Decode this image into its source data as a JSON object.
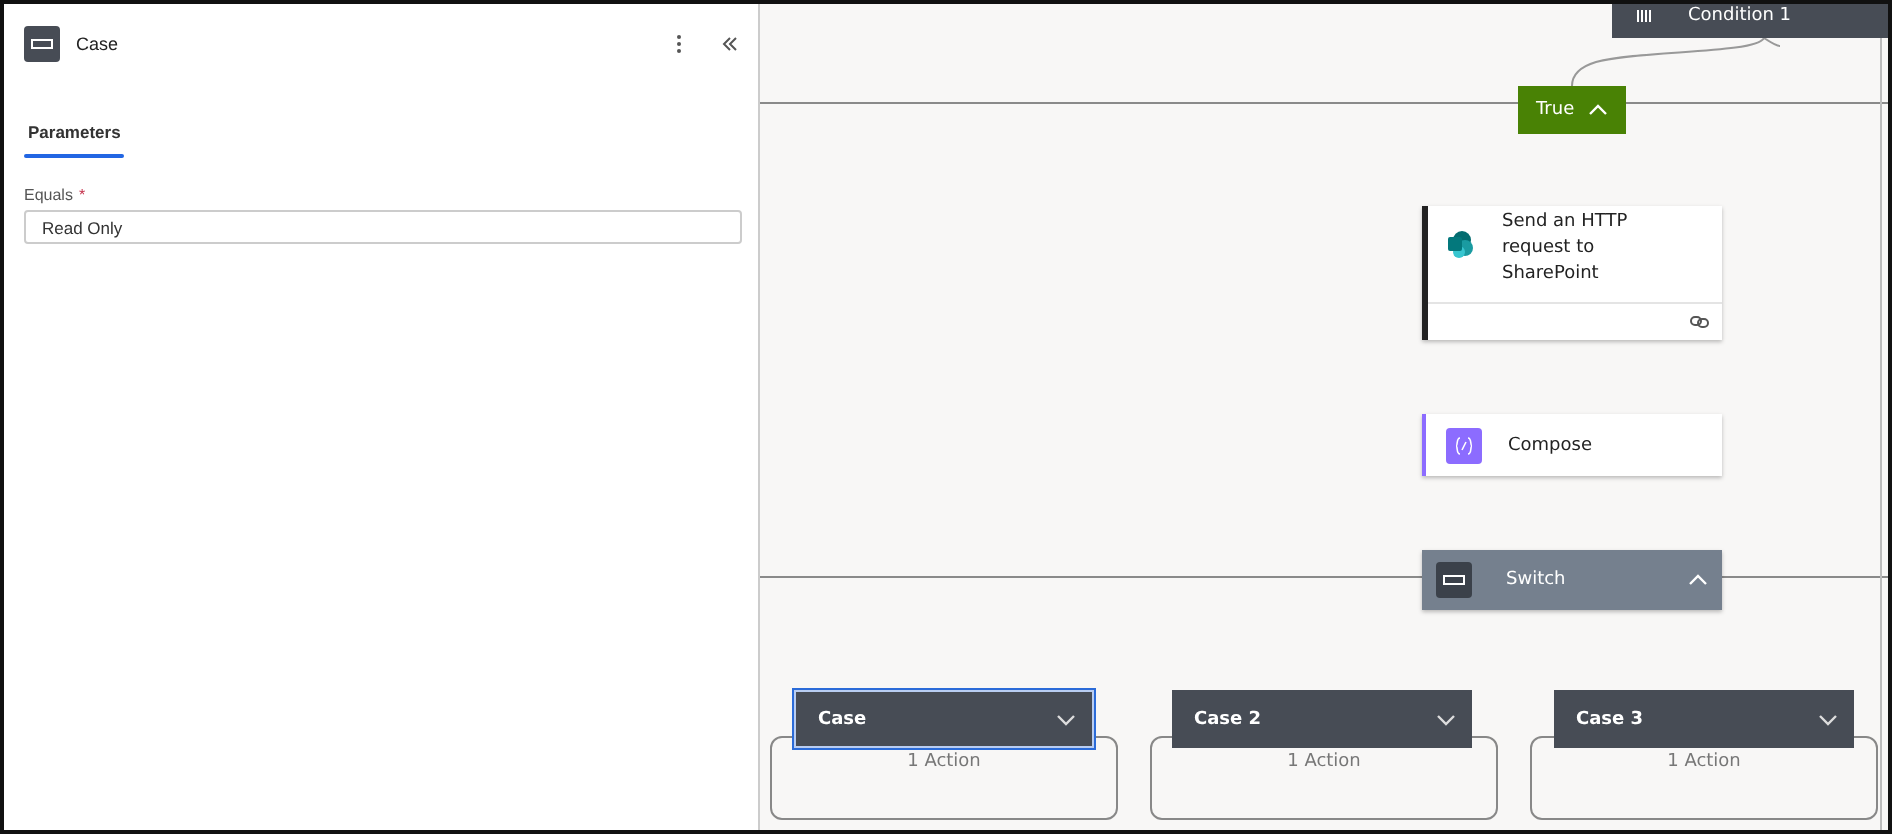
{
  "panel": {
    "title": "Case",
    "tabs": [
      {
        "label": "Parameters",
        "selected": true
      }
    ],
    "field": {
      "label": "Equals",
      "required_mark": "*",
      "value": "Read Only"
    }
  },
  "canvas": {
    "nodes": [
      {
        "kind": "condition",
        "title": "Condition 1"
      },
      {
        "kind": "branch",
        "title": "True",
        "expanded": true
      },
      {
        "kind": "action",
        "title": "Send an HTTP request to SharePoint"
      },
      {
        "kind": "compose",
        "title": "Compose"
      },
      {
        "kind": "switch",
        "title": "Switch",
        "expanded": true
      }
    ],
    "cases": [
      {
        "title": "Case",
        "selected": true,
        "expanded": false,
        "summary": "1 Action"
      },
      {
        "title": "Case 2",
        "selected": false,
        "expanded": false,
        "summary": "1 Action"
      },
      {
        "title": "Case 3",
        "selected": false,
        "expanded": false,
        "summary": "1 Action"
      }
    ]
  }
}
